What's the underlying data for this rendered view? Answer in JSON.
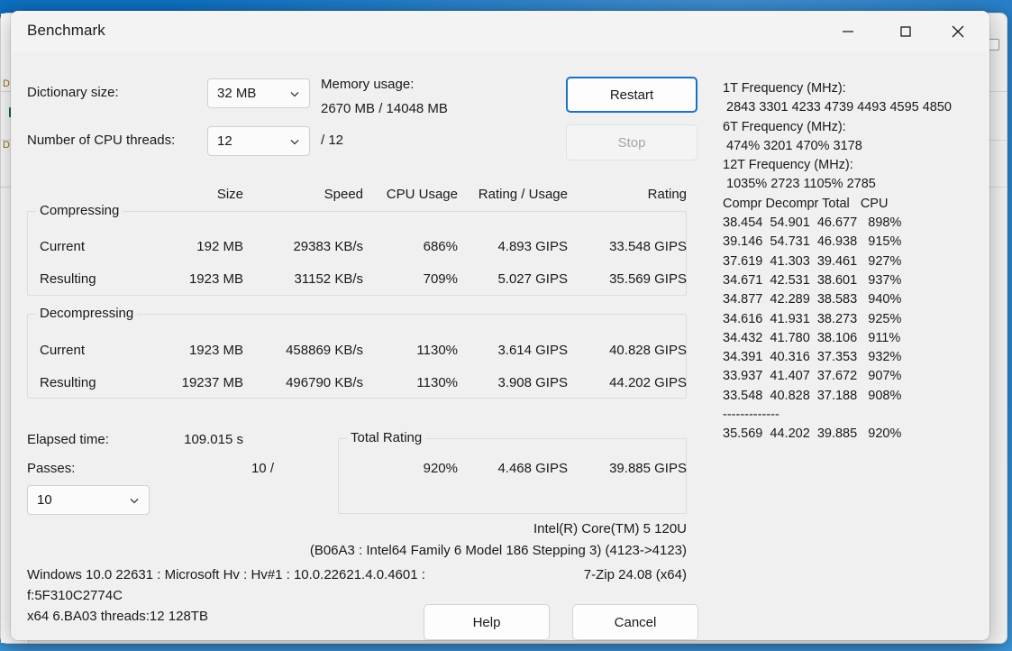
{
  "window": {
    "title": "Benchmark",
    "controls": {
      "minimize": "minimize-icon",
      "maximize": "maximize-icon",
      "close": "close-icon"
    }
  },
  "settings": {
    "dictionary_label": "Dictionary size:",
    "dictionary_value": "32 MB",
    "threads_label": "Number of CPU threads:",
    "threads_value": "12",
    "threads_max": "/ 12",
    "memory_label": "Memory usage:",
    "memory_value": "2670 MB / 14048 MB"
  },
  "actions": {
    "restart": "Restart",
    "stop": "Stop",
    "help": "Help",
    "cancel": "Cancel"
  },
  "table": {
    "headers": [
      "Size",
      "Speed",
      "CPU Usage",
      "Rating / Usage",
      "Rating"
    ],
    "compressing": {
      "title": "Compressing",
      "rows": [
        {
          "label": "Current",
          "size": "192 MB",
          "speed": "29383 KB/s",
          "cpu": "686%",
          "rating_usage": "4.893 GIPS",
          "rating": "33.548 GIPS"
        },
        {
          "label": "Resulting",
          "size": "1923 MB",
          "speed": "31152 KB/s",
          "cpu": "709%",
          "rating_usage": "5.027 GIPS",
          "rating": "35.569 GIPS"
        }
      ]
    },
    "decompressing": {
      "title": "Decompressing",
      "rows": [
        {
          "label": "Current",
          "size": "1923 MB",
          "speed": "458869 KB/s",
          "cpu": "1130%",
          "rating_usage": "3.614 GIPS",
          "rating": "40.828 GIPS"
        },
        {
          "label": "Resulting",
          "size": "19237 MB",
          "speed": "496790 KB/s",
          "cpu": "1130%",
          "rating_usage": "3.908 GIPS",
          "rating": "44.202 GIPS"
        }
      ]
    }
  },
  "status": {
    "elapsed_label": "Elapsed time:",
    "elapsed_value": "109.015 s",
    "passes_label": "Passes:",
    "passes_value": "10 /",
    "passes_select": "10"
  },
  "total_rating": {
    "title": "Total Rating",
    "cpu": "920%",
    "rating_usage": "4.468 GIPS",
    "rating": "39.885 GIPS"
  },
  "log": {
    "freq_1t_label": "1T Frequency (MHz):",
    "freq_1t_value": " 2843 3301 4233 4739 4493 4595 4850",
    "freq_6t_label": "6T Frequency (MHz):",
    "freq_6t_value": " 474% 3201 470% 3178",
    "freq_12t_label": "12T Frequency (MHz):",
    "freq_12t_value": " 1035% 2723 1105% 2785",
    "columns": "Compr Decompr Total   CPU",
    "rows": [
      "38.454  54.901  46.677   898%",
      "39.146  54.731  46.938   915%",
      "37.619  41.303  39.461   927%",
      "34.671  42.531  38.601   937%",
      "34.877  42.289  38.583   940%",
      "34.616  41.931  38.273   925%",
      "34.432  41.780  38.106   911%",
      "34.391  40.316  37.353   932%",
      "33.937  41.407  37.672   907%",
      "33.548  40.828  37.188   908%"
    ],
    "separator": "-------------",
    "total_row": "35.569  44.202  39.885   920%"
  },
  "system": {
    "cpu_name": "Intel(R) Core(TM) 5 120U",
    "cpu_detail": "(B06A3 : Intel64 Family 6 Model 186 Stepping 3) (4123->4123)",
    "os_line": "Windows 10.0 22631 : Microsoft Hv : Hv#1 : 10.0.22621.4.0.4601 :",
    "os_line2": "f:5F310C2774C",
    "arch_line": "x64 6.BA03 threads:12 128TB",
    "app_version": "7-Zip 24.08 (x64)"
  },
  "colors": {
    "accent": "#1a72c4",
    "dialog_bg": "#f0f0f0",
    "text": "#191919"
  }
}
